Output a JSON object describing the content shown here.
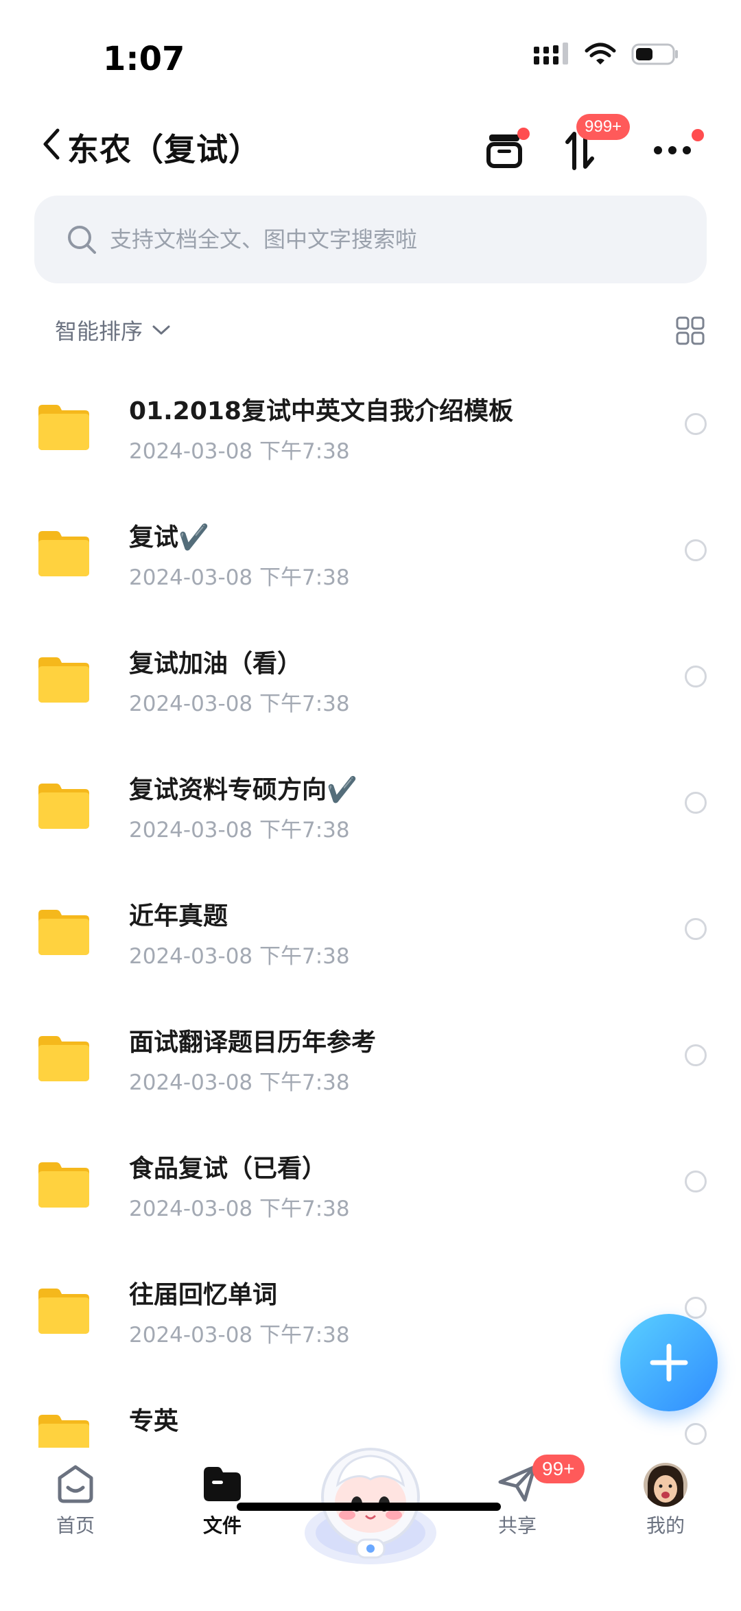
{
  "status_bar": {
    "time": "1:07"
  },
  "nav": {
    "title": "东农（复试）",
    "transfer_badge": "999+"
  },
  "search": {
    "placeholder": "支持文档全文、图中文字搜索啦"
  },
  "sort": {
    "label": "智能排序"
  },
  "files": [
    {
      "name": "01.2018复试中英文自我介绍模板",
      "date": "2024-03-08 下午7:38"
    },
    {
      "name": "复试✔️",
      "date": "2024-03-08 下午7:38"
    },
    {
      "name": "复试加油（看）",
      "date": "2024-03-08 下午7:38"
    },
    {
      "name": "复试资料专硕方向✔️",
      "date": "2024-03-08 下午7:38"
    },
    {
      "name": "近年真题",
      "date": "2024-03-08 下午7:38"
    },
    {
      "name": "面试翻译题目历年参考",
      "date": "2024-03-08 下午7:38"
    },
    {
      "name": "食品复试（已看）",
      "date": "2024-03-08 下午7:38"
    },
    {
      "name": "往届回忆单词",
      "date": "2024-03-08 下午7:38"
    },
    {
      "name": "专英",
      "date": ""
    }
  ],
  "tabs": {
    "home": "首页",
    "files": "文件",
    "share": "共享",
    "share_badge": "99+",
    "mine": "我的"
  },
  "colors": {
    "folder": "#ffcf3a",
    "accent": "#2f8cff",
    "badge": "#ff5a5a"
  }
}
